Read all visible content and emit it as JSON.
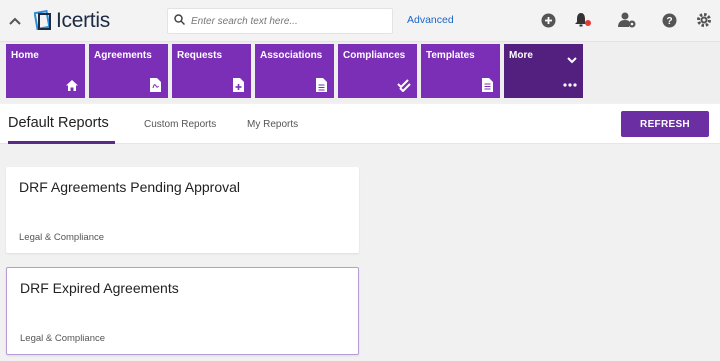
{
  "header": {
    "logo_text": "Icertis",
    "search_placeholder": "Enter search text here...",
    "advanced_label": "Advanced",
    "icons": [
      "chevron-up-icon",
      "search-icon",
      "plus-circle-icon",
      "bell-icon",
      "user-settings-icon",
      "help-icon",
      "gear-icon"
    ],
    "notification_dot_color": "#e53935"
  },
  "nav": {
    "tiles": [
      {
        "label": "Home",
        "icon": "home-icon"
      },
      {
        "label": "Agreements",
        "icon": "pdf-document-icon"
      },
      {
        "label": "Requests",
        "icon": "add-document-icon"
      },
      {
        "label": "Associations",
        "icon": "document-icon"
      },
      {
        "label": "Compliances",
        "icon": "double-check-icon"
      },
      {
        "label": "Templates",
        "icon": "template-icon"
      },
      {
        "label": "More",
        "icon": "ellipsis-icon"
      }
    ],
    "tile_color": "#7b2fb6",
    "more_color": "#54207f"
  },
  "tabs": {
    "active": "Default Reports",
    "items": [
      "Default Reports",
      "Custom Reports",
      "My Reports"
    ],
    "refresh_label": "REFRESH"
  },
  "reports": [
    {
      "title": "DRF Agreements Pending Approval",
      "category": "Legal & Compliance"
    },
    {
      "title": "DRF Expired Agreements",
      "category": "Legal & Compliance"
    }
  ]
}
